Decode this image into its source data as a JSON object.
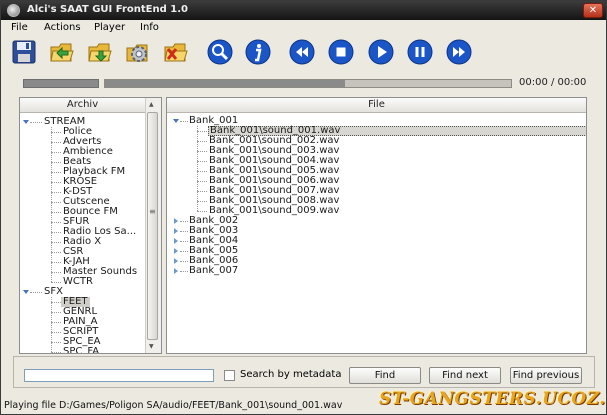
{
  "window": {
    "title": "Alci's SAAT GUI FrontEnd 1.0",
    "close_glyph": "✕"
  },
  "menu": [
    "File",
    "Actions",
    "Player",
    "Info"
  ],
  "toolbar": {
    "buttons": [
      {
        "name": "save-icon"
      },
      {
        "name": "open-folder-icon"
      },
      {
        "name": "folder-plus-icon"
      },
      {
        "name": "gear-folder-icon"
      },
      {
        "name": "delete-folder-icon"
      },
      {
        "name": "search-icon"
      },
      {
        "name": "info-icon"
      },
      {
        "name": "rewind-icon"
      },
      {
        "name": "stop-icon"
      },
      {
        "name": "play-icon"
      },
      {
        "name": "pause-icon"
      },
      {
        "name": "fast-forward-icon"
      }
    ]
  },
  "player": {
    "time": "00:00 / 00:00",
    "progress_fraction": 0.59
  },
  "archive": {
    "header": "Archiv",
    "groups": [
      {
        "label": "STREAM",
        "items": [
          "Police",
          "Adverts",
          "Ambience",
          "Beats",
          "Playback FM",
          "KROSE",
          "K-DST",
          "Cutscene",
          "Bounce FM",
          "SFUR",
          "Radio Los Sa...",
          "Radio X",
          "CSR",
          "K-JAH",
          "Master Sounds",
          "WCTR"
        ]
      },
      {
        "label": "SFX",
        "items": [
          "FEET",
          "GENRL",
          "PAIN_A",
          "SCRIPT",
          "SPC_EA",
          "SPC_FA"
        ]
      }
    ],
    "selected": "FEET",
    "scroll_grip": "≡"
  },
  "files": {
    "header": "File",
    "expanded_bank": "Bank_001",
    "sounds": [
      "Bank_001\\sound_001.wav",
      "Bank_001\\sound_002.wav",
      "Bank_001\\sound_003.wav",
      "Bank_001\\sound_004.wav",
      "Bank_001\\sound_005.wav",
      "Bank_001\\sound_006.wav",
      "Bank_001\\sound_007.wav",
      "Bank_001\\sound_008.wav",
      "Bank_001\\sound_009.wav"
    ],
    "selected_sound": "Bank_001\\sound_001.wav",
    "collapsed_banks": [
      "Bank_002",
      "Bank_003",
      "Bank_004",
      "Bank_005",
      "Bank_006",
      "Bank_007"
    ]
  },
  "search": {
    "input_value": "",
    "metadata_label": "Search by metadata",
    "find_label": "Find",
    "find_next_label": "Find next",
    "find_previous_label": "Find previous"
  },
  "status": {
    "text": "Playing file D:/Games/Poligon SA/audio/FEET/Bank_001\\sound_001.wav"
  },
  "watermark": {
    "text": "ST-GANGSTERS.UCOZ.COM"
  },
  "colors": {
    "accent_blue": "#1b56c9",
    "titlebar": "#1f1f1f",
    "folder_yellow": "#f2c94c",
    "watermark": "#e8a51c"
  }
}
